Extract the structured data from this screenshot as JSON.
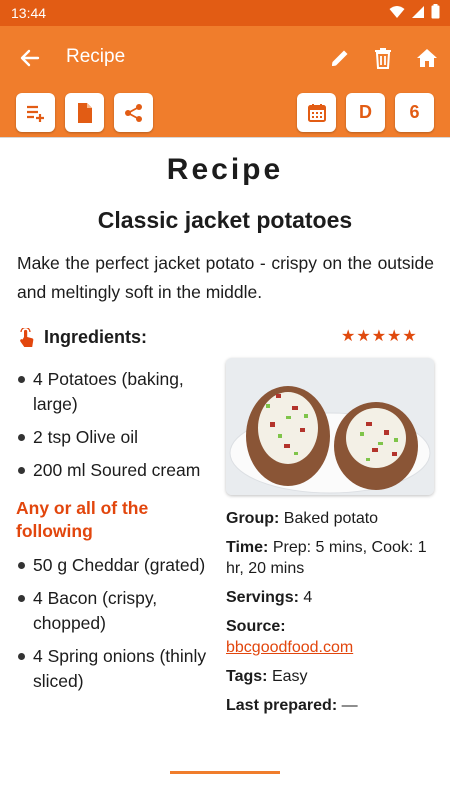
{
  "status_bar": {
    "time": "13:44"
  },
  "app_bar": {
    "title": "Recipe",
    "back_icon": "arrow-left-icon",
    "actions": [
      "pencil-icon",
      "trash-icon",
      "home-icon"
    ]
  },
  "toolbar": {
    "left_icons": [
      "playlist-add-icon",
      "document-icon",
      "share-icon"
    ],
    "calendar_icon": "calendar-icon",
    "day_label": "D",
    "count_label": "6"
  },
  "recipe": {
    "heading": "Recipe",
    "title": "Classic jacket potatoes",
    "description": "Make the perfect jacket potato - crispy on the outside and meltingly soft in the middle.",
    "ingredients_label": "Ingredients:",
    "rating": 5,
    "ingredients": [
      "4 Potatoes (baking, large)",
      "2 tsp Olive oil",
      "200 ml Soured cream"
    ],
    "group_title": "Any or all of the following",
    "group_ingredients": [
      "50 g Cheddar (grated)",
      "4 Bacon (crispy, chopped)",
      "4 Spring onions (thinly sliced)"
    ],
    "info": {
      "group_label": "Group:",
      "group_value": "Baked potato",
      "time_label": "Time:",
      "time_value": "Prep: 5 mins, Cook: 1 hr, 20 mins",
      "servings_label": "Servings:",
      "servings_value": "4",
      "source_label": "Source:",
      "source_value": "bbcgoodfood.com",
      "tags_label": "Tags:",
      "tags_value": "Easy",
      "last_prepared_label": "Last prepared:",
      "last_prepared_value": "—"
    }
  },
  "colors": {
    "app_bar": "#f07d2c",
    "status_bar": "#e25c14",
    "accent": "#e2460d"
  }
}
